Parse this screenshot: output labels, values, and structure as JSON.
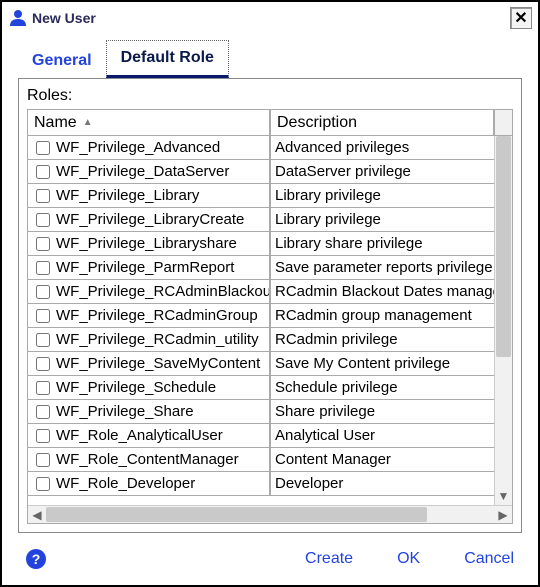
{
  "window": {
    "title": "New User",
    "close_glyph": "✕"
  },
  "tabs": {
    "general": "General",
    "default_role": "Default Role"
  },
  "panel": {
    "roles_label": "Roles:"
  },
  "columns": {
    "name": "Name",
    "description": "Description",
    "sort_glyph": "▲"
  },
  "roles": [
    {
      "name": "WF_Privilege_Advanced",
      "description": "Advanced privileges"
    },
    {
      "name": "WF_Privilege_DataServer",
      "description": "DataServer privilege"
    },
    {
      "name": "WF_Privilege_Library",
      "description": "Library privilege"
    },
    {
      "name": "WF_Privilege_LibraryCreate",
      "description": "Library privilege"
    },
    {
      "name": "WF_Privilege_Libraryshare",
      "description": "Library share privilege"
    },
    {
      "name": "WF_Privilege_ParmReport",
      "description": "Save parameter reports privilege"
    },
    {
      "name": "WF_Privilege_RCAdminBlackout",
      "description": "RCadmin Blackout Dates management"
    },
    {
      "name": "WF_Privilege_RCadminGroup",
      "description": "RCadmin group management"
    },
    {
      "name": "WF_Privilege_RCadmin_utility",
      "description": "RCadmin privilege"
    },
    {
      "name": "WF_Privilege_SaveMyContent",
      "description": "Save My Content privilege"
    },
    {
      "name": "WF_Privilege_Schedule",
      "description": "Schedule privilege"
    },
    {
      "name": "WF_Privilege_Share",
      "description": "Share privilege"
    },
    {
      "name": "WF_Role_AnalyticalUser",
      "description": "Analytical User"
    },
    {
      "name": "WF_Role_ContentManager",
      "description": "Content Manager"
    },
    {
      "name": "WF_Role_Developer",
      "description": "Developer"
    }
  ],
  "footer": {
    "help_glyph": "?",
    "create": "Create",
    "ok": "OK",
    "cancel": "Cancel"
  },
  "scroll": {
    "down": "▼",
    "left": "◀",
    "right": "▶"
  }
}
